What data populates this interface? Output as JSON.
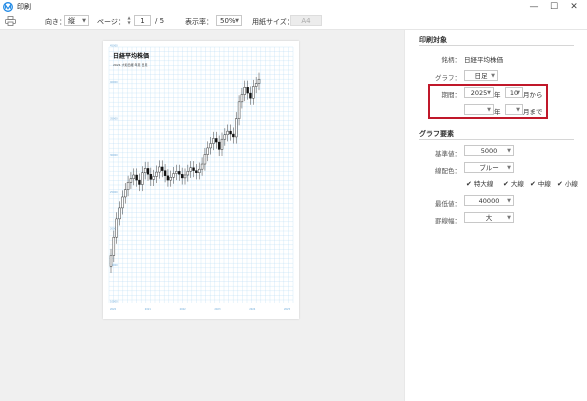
{
  "window": {
    "title": "印刷",
    "minimize": "—",
    "maximize": "☐",
    "close": "✕"
  },
  "toolbar": {
    "orientation_label": "向き：",
    "orientation_value": "縦",
    "page_label": "ページ：",
    "page_current": "1",
    "page_total": "/ 5",
    "zoom_label": "表示率：",
    "zoom_value": "50%",
    "paper_label": "用紙サイズ：",
    "paper_value": "A4"
  },
  "paper": {
    "title": "日経平均株価",
    "subtitle": "2021 大和日経 年足 日足"
  },
  "chart_data": {
    "type": "candlestick",
    "title": "日経平均株価",
    "x_tick_labels": [
      "2020",
      "2021",
      "2022",
      "2023",
      "2024",
      "2025"
    ],
    "y_tick_labels": [
      "45000",
      "40000",
      "35000",
      "30000",
      "25000",
      "20000",
      "15000",
      "10000"
    ],
    "ylim": [
      10000,
      45000
    ],
    "grid": true,
    "closes": [
      16500,
      19000,
      21500,
      23000,
      24500,
      25500,
      26500,
      27000,
      27500,
      26800,
      26200,
      27800,
      28400,
      27600,
      26900,
      27300,
      27900,
      28600,
      28100,
      27400,
      26800,
      27200,
      27700,
      28000,
      27600,
      27100,
      27500,
      28000,
      28500,
      28100,
      27800,
      28300,
      29000,
      30300,
      31200,
      31800,
      32500,
      32000,
      31000,
      32400,
      33000,
      33500,
      33100,
      32700,
      35200,
      37500,
      38500,
      39500,
      38700,
      38000,
      39600,
      40000,
      40600
    ]
  },
  "panel": {
    "print_target_title": "印刷対象",
    "stock_label": "銘柄：",
    "stock_value": "日経平均株価",
    "graph_label": "グラフ：",
    "graph_value": "日足",
    "period_label": "期間：",
    "from_year": "2025",
    "year_unit": "年",
    "from_month": "10",
    "from_suffix": "月から",
    "to_year": "",
    "to_month": "",
    "to_suffix": "月まで",
    "graph_elements_title": "グラフ要素",
    "base_label": "基準値：",
    "base_value": "5000",
    "line_color_label": "線配色：",
    "line_color_value": "ブルー",
    "checkbox_extra_thick": "特大線",
    "checkbox_thick": "大線",
    "checkbox_medium": "中線",
    "checkbox_thin": "小線",
    "max_label": "最低値：",
    "max_value": "40000",
    "scale_label": "罫線幅：",
    "scale_value": "大"
  },
  "colors": {
    "highlight": "#c0182a",
    "grid": "#b8dcf4",
    "app_logo": "#1e88e5"
  }
}
